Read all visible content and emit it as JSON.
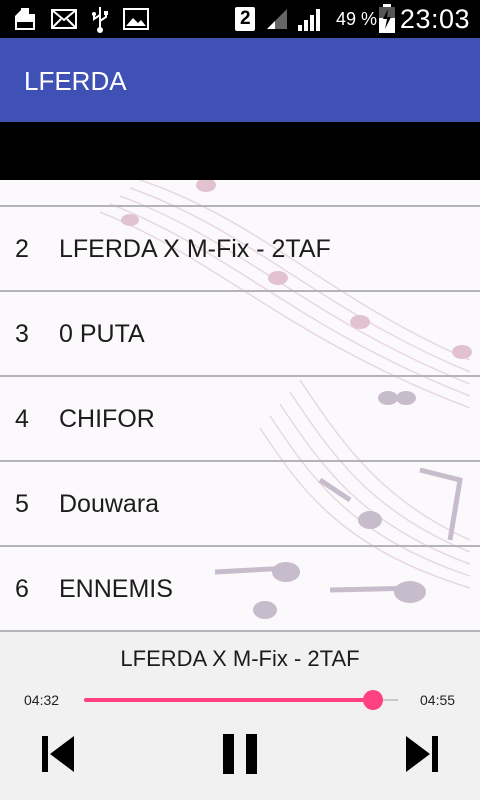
{
  "status_bar": {
    "icons_left": [
      "sd-card-icon",
      "mail-icon",
      "usb-icon",
      "image-icon"
    ],
    "sim_number": "2",
    "battery_percent": "49 %",
    "time": "23:03"
  },
  "app_bar": {
    "title": "LFERDA"
  },
  "tracks": [
    {
      "number": "2",
      "title": "LFERDA X M-Fix - 2TAF"
    },
    {
      "number": "3",
      "title": "0 PUTA"
    },
    {
      "number": "4",
      "title": "CHIFOR"
    },
    {
      "number": "5",
      "title": "Douwara"
    },
    {
      "number": "6",
      "title": "ENNEMIS"
    }
  ],
  "player": {
    "now_playing": "LFERDA X M-Fix - 2TAF",
    "elapsed": "04:32",
    "total": "04:55",
    "progress": 0.92,
    "controls": [
      "previous-icon",
      "pause-icon",
      "next-icon"
    ]
  },
  "colors": {
    "app_bar": "#3f51b5",
    "accent": "#ff4081",
    "status_bar": "#000000"
  }
}
